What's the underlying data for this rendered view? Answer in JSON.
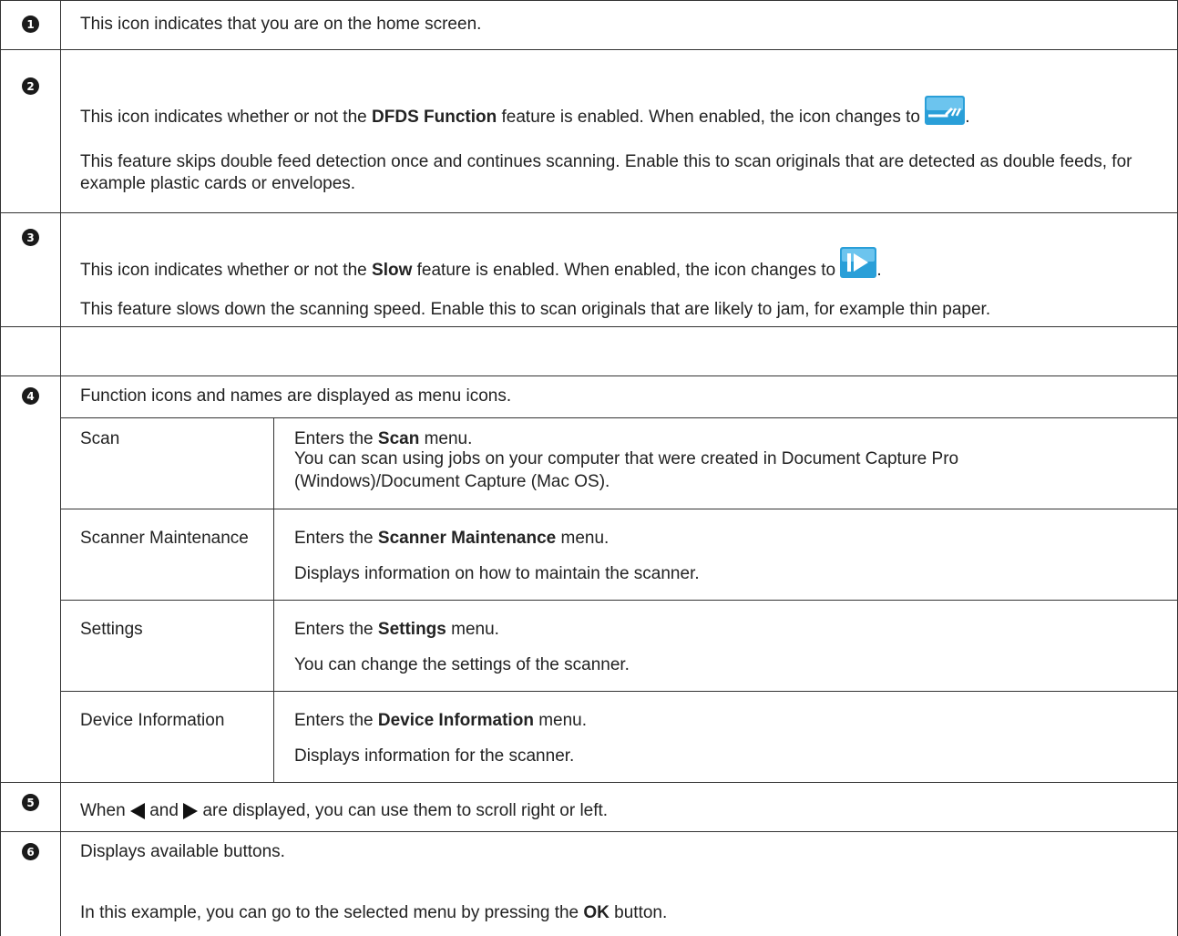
{
  "rows": [
    {
      "num": "1",
      "text": "This icon indicates that you are on the home screen."
    },
    {
      "num": "2",
      "line1": {
        "pre": "This icon indicates whether or not the ",
        "bold": "DFDS Function",
        "post": " feature is enabled. When enabled, the icon changes to ",
        "end": "."
      },
      "line2": "This feature skips double feed detection once and continues scanning. Enable this to scan originals that are detected as double feeds, for example plastic cards or envelopes.",
      "icon": "dfds-function-icon"
    },
    {
      "num": "3",
      "line1": {
        "pre": "This icon indicates whether or not the ",
        "bold": "Slow",
        "post": " feature is enabled. When enabled, the icon changes to ",
        "end": "."
      },
      "line2": "This feature slows down the scanning speed. Enable this to scan originals that are likely to jam, for example thin paper.",
      "icon": "slow-mode-icon"
    },
    {
      "num": "4",
      "text": "Function icons and names are displayed as menu icons.",
      "menu": [
        {
          "name": "Scan",
          "enter_pre": "Enters the ",
          "enter_bold": "Scan",
          "enter_post": " menu.",
          "desc": "You can scan using jobs on your computer that were created in Document Capture Pro (Windows)/Document Capture (Mac OS)."
        },
        {
          "name": "Scanner Maintenance",
          "enter_pre": "Enters the ",
          "enter_bold": "Scanner Maintenance",
          "enter_post": " menu.",
          "desc": "Displays information on how to maintain the scanner."
        },
        {
          "name": "Settings",
          "enter_pre": "Enters the ",
          "enter_bold": "Settings",
          "enter_post": " menu.",
          "desc": "You can change the settings of the scanner."
        },
        {
          "name": "Device Information",
          "enter_pre": "Enters the ",
          "enter_bold": "Device Information",
          "enter_post": " menu.",
          "desc": "Displays information for the scanner."
        }
      ]
    },
    {
      "num": "5",
      "pre": "When ",
      "mid": " and ",
      "post": " are displayed, you can use them to scroll right or left."
    },
    {
      "num": "6",
      "text": "Displays available buttons.",
      "line2": {
        "pre": "In this example, you can go to the selected menu by pressing the ",
        "bold": "OK",
        "post": " button."
      }
    }
  ],
  "colors": {
    "border": "#333333",
    "badge": "#1a1a1a",
    "icon_blue": "#2a9fd8"
  }
}
